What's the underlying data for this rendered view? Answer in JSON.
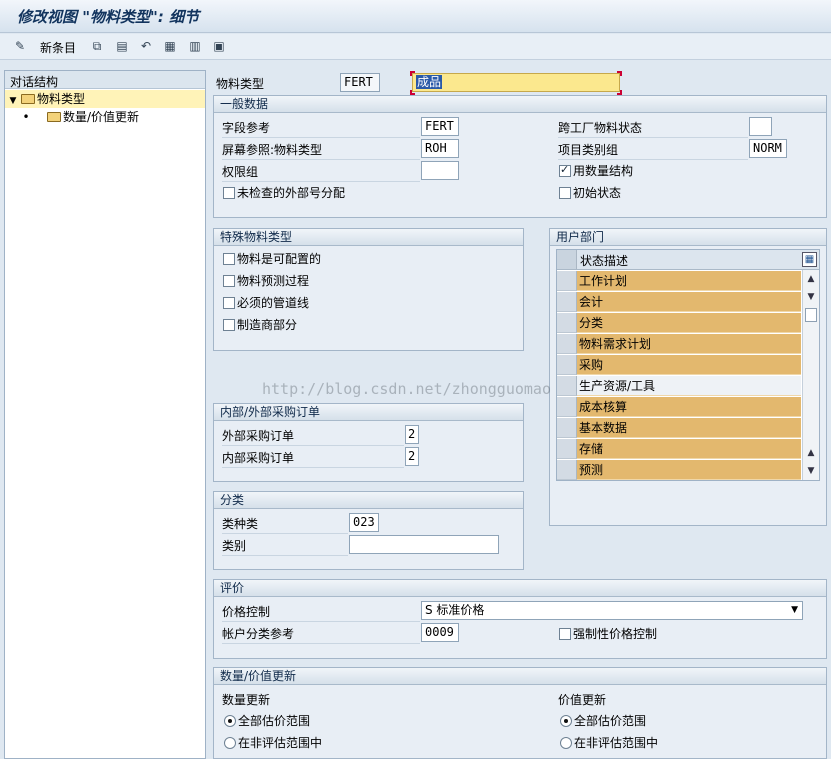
{
  "window": {
    "title": "修改视图 \"物料类型\": 细节"
  },
  "toolbar": {
    "new_entry": "新条目"
  },
  "tree": {
    "header": "对话结构",
    "items": [
      {
        "label": "物料类型",
        "selected": true
      },
      {
        "label": "数量/价值更新",
        "selected": false
      }
    ]
  },
  "top": {
    "label": "物料类型",
    "code": "FERT",
    "description": "成品"
  },
  "general": {
    "title": "一般数据",
    "field_ref_label": "字段参考",
    "field_ref_value": "FERT",
    "screen_ref_label": "屏幕参照:物料类型",
    "screen_ref_value": "ROH",
    "auth_group_label": "权限组",
    "auth_group_value": "",
    "unchecked_ext_label": "未检查的外部号分配",
    "cross_plant_label": "跨工厂物料状态",
    "cross_plant_value": "",
    "item_cat_label": "项目类别组",
    "item_cat_value": "NORM",
    "qty_struct_label": "用数量结构",
    "initial_status_label": "初始状态"
  },
  "special": {
    "title": "特殊物料类型",
    "items": [
      "物料是可配置的",
      "物料预测过程",
      "必须的管道线",
      "制造商部分"
    ]
  },
  "user_dept": {
    "title": "用户部门",
    "column": "状态描述",
    "rows": [
      {
        "label": "工作计划",
        "highlighted": true
      },
      {
        "label": "会计",
        "highlighted": true
      },
      {
        "label": "分类",
        "highlighted": true
      },
      {
        "label": "物料需求计划",
        "highlighted": true
      },
      {
        "label": "采购",
        "highlighted": true
      },
      {
        "label": "生产资源/工具",
        "highlighted": false
      },
      {
        "label": "成本核算",
        "highlighted": true
      },
      {
        "label": "基本数据",
        "highlighted": true
      },
      {
        "label": "存储",
        "highlighted": true
      },
      {
        "label": "预测",
        "highlighted": true
      }
    ]
  },
  "po": {
    "title": "内部/外部采购订单",
    "external_label": "外部采购订单",
    "external_value": "2",
    "internal_label": "内部采购订单",
    "internal_value": "2"
  },
  "classification": {
    "title": "分类",
    "class_type_label": "类种类",
    "class_type_value": "023",
    "class_label": "类别",
    "class_value": ""
  },
  "valuation": {
    "title": "评价",
    "price_control_label": "价格控制",
    "price_control_value": "S 标准价格",
    "acct_cat_label": "帐户分类参考",
    "acct_cat_value": "0009",
    "mandatory_label": "强制性价格控制"
  },
  "qty_value": {
    "title": "数量/价值更新",
    "qty_update_label": "数量更新",
    "value_update_label": "价值更新",
    "all_areas": "全部估价范围",
    "not_in_area": "在非评估范围中"
  },
  "watermark": "http://blog.csdn.net/zhongguomao"
}
